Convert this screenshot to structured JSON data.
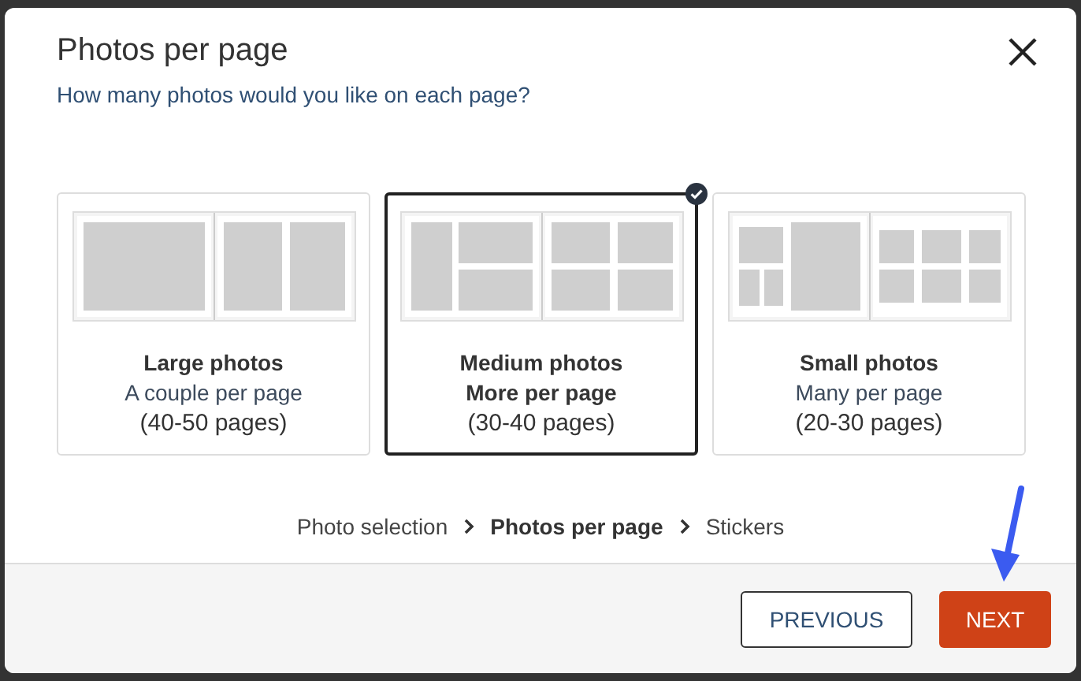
{
  "dialog": {
    "title": "Photos per page",
    "subtitle": "How many photos would you like on each page?"
  },
  "options": [
    {
      "kind": "large",
      "title": "Large photos",
      "subtitle": "A couple per page",
      "pages": "(40-50 pages)",
      "selected": false
    },
    {
      "kind": "medium",
      "title": "Medium photos",
      "subtitle": "More per page",
      "pages": "(30-40 pages)",
      "selected": true
    },
    {
      "kind": "small",
      "title": "Small photos",
      "subtitle": "Many per page",
      "pages": "(20-30 pages)",
      "selected": false
    }
  ],
  "steps": [
    {
      "label": "Photo selection",
      "selected": false
    },
    {
      "label": "Photos per page",
      "selected": true
    },
    {
      "label": "Stickers",
      "selected": false
    }
  ],
  "buttons": [
    {
      "label": "PREVIOUS",
      "kind": "secondary"
    },
    {
      "label": "NEXT",
      "kind": "primary"
    }
  ]
}
